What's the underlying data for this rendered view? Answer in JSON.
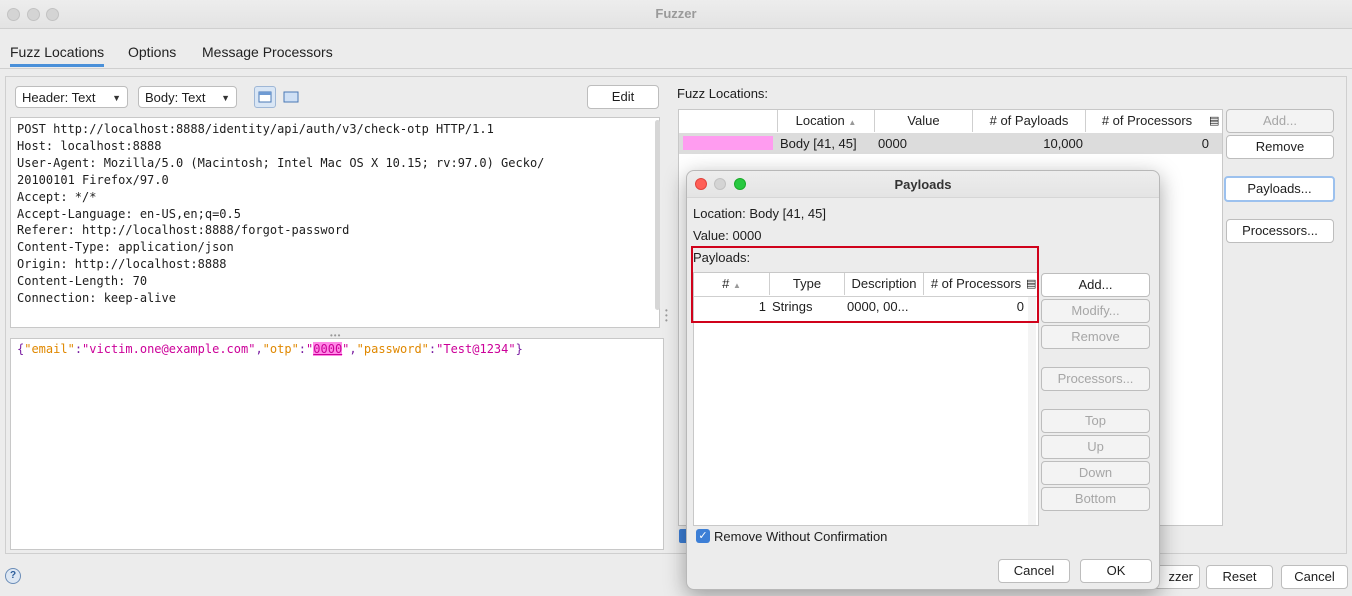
{
  "window": {
    "title": "Fuzzer"
  },
  "tabs": [
    {
      "label": "Fuzz Locations"
    },
    {
      "label": "Options"
    },
    {
      "label": "Message Processors"
    }
  ],
  "editor": {
    "header_combo": "Header: Text",
    "body_combo": "Body: Text",
    "edit_button": "Edit",
    "request_lines": [
      "POST http://localhost:8888/identity/api/auth/v3/check-otp HTTP/1.1",
      "Host: localhost:8888",
      "User-Agent: Mozilla/5.0 (Macintosh; Intel Mac OS X 10.15; rv:97.0) Gecko/",
      "20100101 Firefox/97.0",
      "Accept: */*",
      "Accept-Language: en-US,en;q=0.5",
      "Referer: http://localhost:8888/forgot-password",
      "Content-Type: application/json",
      "Origin: http://localhost:8888",
      "Content-Length: 70",
      "Connection: keep-alive"
    ],
    "body": {
      "p1": "{",
      "k1": "\"email\"",
      "c1": ":",
      "v1": "\"victim.one@example.com\"",
      "c2": ",",
      "k2": "\"otp\"",
      "c3": ":",
      "q1": "\"",
      "otp": "0000",
      "q2": "\"",
      "c4": ",",
      "k3": "\"password\"",
      "c5": ":",
      "v3": "\"Test@1234\"",
      "p2": "}"
    }
  },
  "fuzz_locations": {
    "label": "Fuzz Locations:",
    "columns": [
      "Location",
      "Value",
      "# of Payloads",
      "# of Processors"
    ],
    "rows": [
      {
        "location": "Body [41, 45]",
        "value": "0000",
        "payloads": "10,000",
        "processors": "0"
      }
    ],
    "buttons": {
      "add": "Add...",
      "remove": "Remove",
      "payloads": "Payloads...",
      "processors": "Processors..."
    }
  },
  "payloads_dialog": {
    "title": "Payloads",
    "location_label": "Location:",
    "location_value": "Body [41, 45]",
    "value_label": "Value:",
    "value_value": "0000",
    "payloads_label": "Payloads:",
    "columns": [
      "#",
      "Type",
      "Description",
      "# of Processors"
    ],
    "rows": [
      {
        "num": "1",
        "type": "Strings",
        "description": "0000, 00...",
        "processors": "0"
      }
    ],
    "buttons": {
      "add": "Add...",
      "modify": "Modify...",
      "remove": "Remove",
      "processors": "Processors...",
      "top": "Top",
      "up": "Up",
      "down": "Down",
      "bottom": "Bottom"
    },
    "remove_without_confirmation": "Remove Without Confirmation",
    "cancel": "Cancel",
    "ok": "OK"
  },
  "footer": {
    "start_partial": "zzer",
    "reset": "Reset",
    "cancel": "Cancel"
  },
  "colors": {
    "accent": "#4a90d9",
    "highlight_pink": "#ff88e6",
    "annotation_red": "#d0021b",
    "json_key": "#e08800",
    "json_value": "#cc0099"
  }
}
